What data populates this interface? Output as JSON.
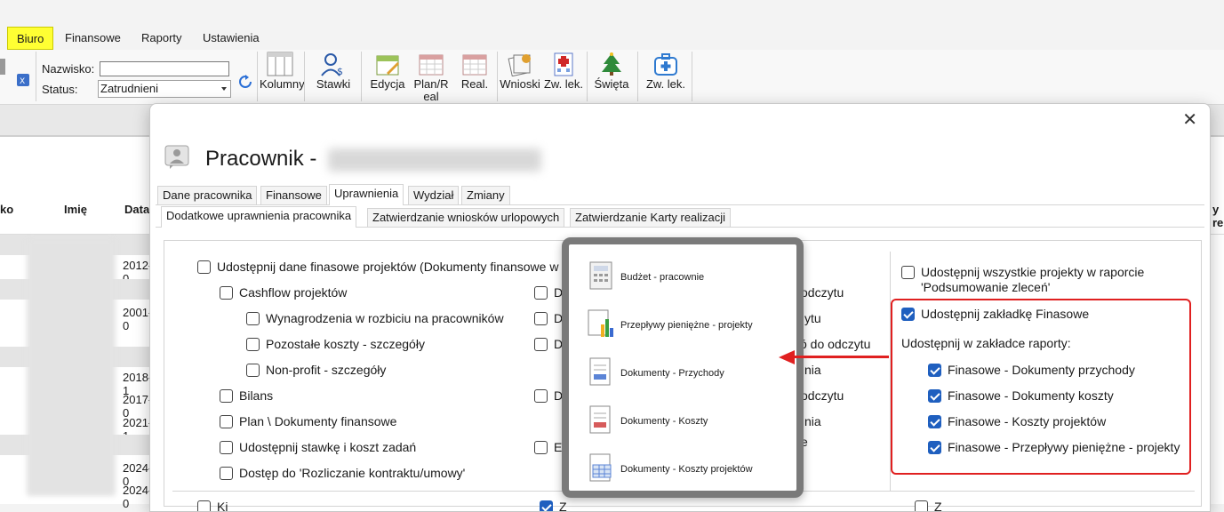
{
  "menu": {
    "items": [
      "Biuro",
      "Finansowe",
      "Raporty",
      "Ustawienia"
    ]
  },
  "ribbon": {
    "nazwisko_label": "Nazwisko:",
    "nazwisko_value": "",
    "status_label": "Status:",
    "status_value": "Zatrudnieni",
    "buttons": {
      "kolumny": "Kolumny",
      "stawki": "Stawki",
      "edycja": "Edycja",
      "plan": "Plan/R eal",
      "real": "Real.",
      "wnioski": "Wnioski",
      "zwlek1": "Zw. lek.",
      "swieta": "Święta",
      "zwlek2": "Zw. lek."
    }
  },
  "grid": {
    "headers": [
      "ko",
      "Imię",
      "Data",
      "y re"
    ],
    "dates": [
      "2012-0",
      "2001-0",
      "2018-1",
      "2017-0",
      "2021-1",
      "2024-0",
      "2024-0"
    ]
  },
  "modal": {
    "title": "Pracownik -",
    "tabs": [
      "Dane pracownika",
      "Finansowe",
      "Uprawnienia",
      "Wydział",
      "Zmiany"
    ],
    "subtabs": [
      "Dodatkowe uprawnienia pracownika",
      "Zatwierdzanie wniosków urlopowych",
      "Zatwierdzanie Karty realizacji"
    ],
    "left": {
      "main": "Udostępnij dane finasowe projektów (Dokumenty finansowe w",
      "cashflow": "Cashflow projektów",
      "wynagrodzenia": "Wynagrodzenia w rozbiciu na pracowników",
      "pozostale": "Pozostałe koszty - szczegóły",
      "nonprofit": "Non-profit - szczegóły",
      "bilans": "Bilans",
      "plan": "Plan \\ Dokumenty finansowe",
      "stawke": "Udostępnij stawkę i koszt zadań",
      "dostep": "Dostęp do 'Rozliczanie kontraktu/umowy'"
    },
    "middle_partial": [
      "D",
      "D",
      "D",
      "D",
      "E"
    ],
    "middle_right_partial": [
      "odczytu",
      "ytu",
      "ó do odczytu",
      "nia",
      "odczytu",
      "nia",
      "e"
    ],
    "right": {
      "all_projects": "Udostępnij wszystkie projekty w raporcie",
      "all_projects2": "'Podsumowanie zleceń'",
      "finansowe_tab": "Udostępnij zakładkę Finasowe",
      "raporty_label": "Udostępnij w zakładce raporty:",
      "r1": "Finasowe - Dokumenty przychody",
      "r2": "Finasowe - Dokumenty koszty",
      "r3": "Finasowe - Koszty projektów",
      "r4": "Finasowe - Przepływy pieniężne - projekty"
    },
    "bottom_partial": [
      "Ki",
      "Z",
      "Z"
    ]
  },
  "popup": {
    "items": [
      "Budżet - pracownie",
      "Przepływy pieniężne - projekty",
      "Dokumenty - Przychody",
      "Dokumenty - Koszty",
      "Dokumenty - Koszty projektów"
    ]
  },
  "colors": {
    "accent_yellow": "#ffff33",
    "checkbox_blue": "#1f5fbf",
    "highlight_red": "#e02020",
    "popup_border": "#7a7a7a"
  }
}
